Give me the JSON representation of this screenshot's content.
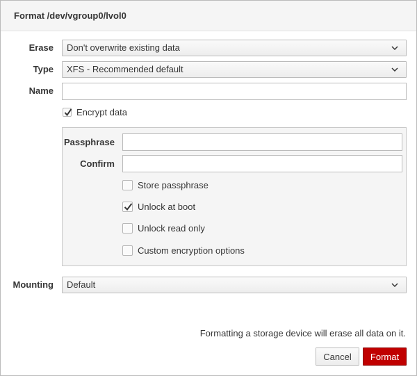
{
  "dialog": {
    "title": "Format /dev/vgroup0/lvol0"
  },
  "fields": {
    "erase": {
      "label": "Erase",
      "value": "Don't overwrite existing data"
    },
    "type": {
      "label": "Type",
      "value": "XFS - Recommended default"
    },
    "name": {
      "label": "Name",
      "value": ""
    },
    "mounting": {
      "label": "Mounting",
      "value": "Default"
    }
  },
  "encrypt": {
    "label": "Encrypt data",
    "checked": true
  },
  "encryption": {
    "passphrase_label": "Passphrase",
    "passphrase_value": "",
    "confirm_label": "Confirm",
    "confirm_value": "",
    "options": [
      {
        "label": "Store passphrase",
        "checked": false
      },
      {
        "label": "Unlock at boot",
        "checked": true
      },
      {
        "label": "Unlock read only",
        "checked": false
      },
      {
        "label": "Custom encryption options",
        "checked": false
      }
    ]
  },
  "footer": {
    "warning": "Formatting a storage device will erase all data on it.",
    "cancel_label": "Cancel",
    "format_label": "Format"
  },
  "colors": {
    "primary_button": "#c00000",
    "panel_background": "#f5f5f5",
    "header_background": "#f5f5f5"
  }
}
